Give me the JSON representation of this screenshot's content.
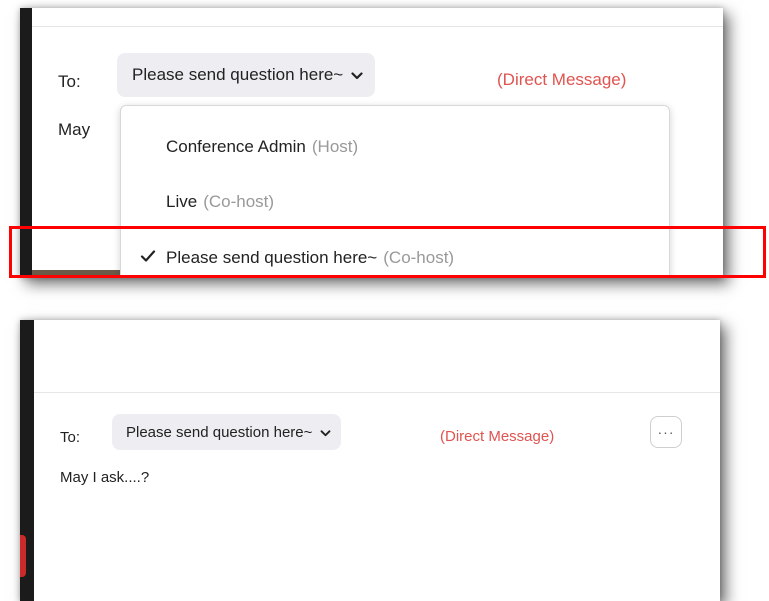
{
  "panel_top": {
    "to_label": "To:",
    "recipient": "Please send question here~",
    "direct_message": "(Direct Message)",
    "message_partial": "May",
    "dropdown": {
      "items": [
        {
          "name": "Conference Admin",
          "role": "(Host)",
          "selected": false
        },
        {
          "name": "Live",
          "role": "(Co-host)",
          "selected": false
        },
        {
          "name": "Please send question here~",
          "role": "(Co-host)",
          "selected": true
        }
      ],
      "check_glyph": "✓"
    },
    "highlight_color": "#ff0000"
  },
  "panel_bottom": {
    "to_label": "To:",
    "recipient": "Please send question here~",
    "direct_message": "(Direct Message)",
    "more_button": "···",
    "message": "May I ask....?"
  },
  "colors": {
    "accent_red": "#e0534f",
    "pill_bg": "#eeeef2",
    "role_gray": "#999999"
  }
}
